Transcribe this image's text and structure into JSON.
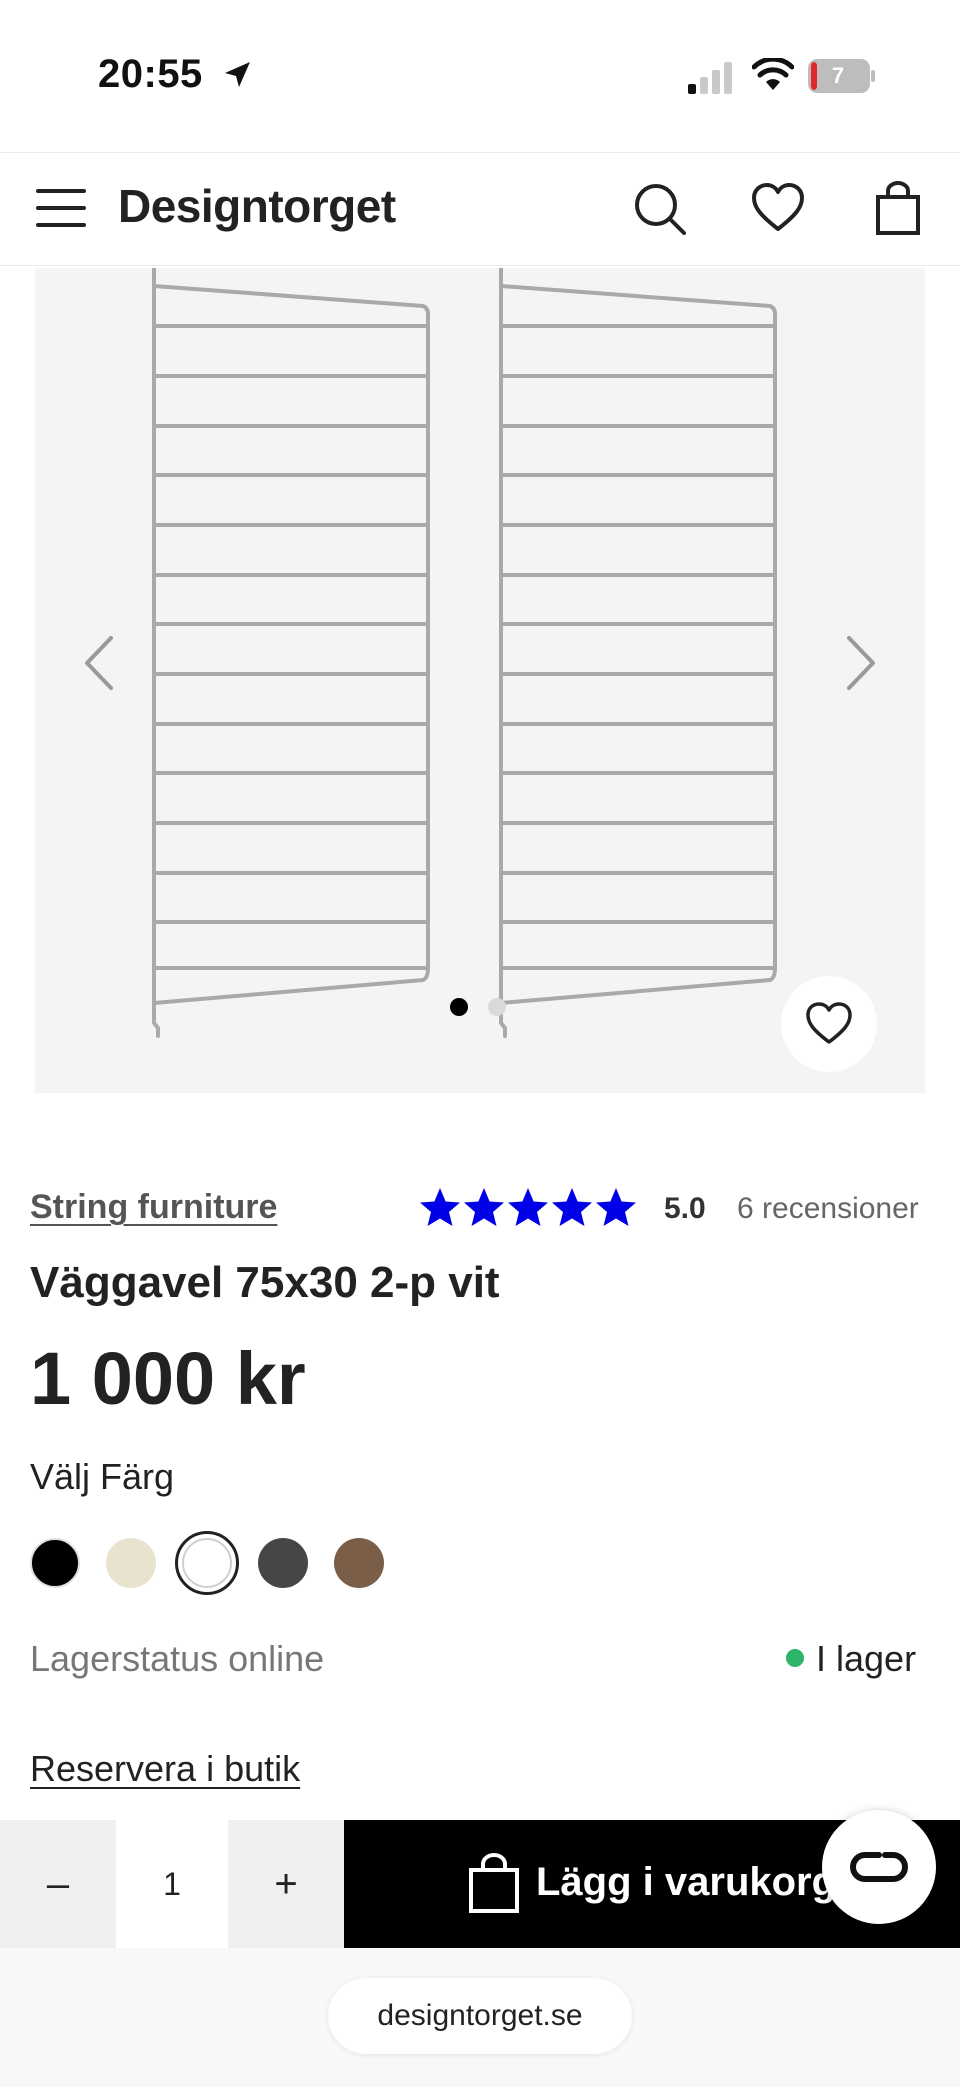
{
  "status_bar": {
    "time": "20:55",
    "battery_level": "7",
    "icons": [
      "location-arrow-icon",
      "cellular-signal-icon",
      "wifi-icon",
      "battery-icon"
    ]
  },
  "header": {
    "logo": "Designtorget",
    "icons": [
      "menu-icon",
      "search-icon",
      "heart-icon",
      "shopping-bag-icon"
    ]
  },
  "gallery": {
    "image_count": 2,
    "active_index": 1,
    "icons": [
      "chevron-left-icon",
      "chevron-right-icon",
      "heart-icon"
    ]
  },
  "product": {
    "brand": "String furniture",
    "rating": {
      "stars": 5,
      "max_stars": 5,
      "score": "5.0",
      "count_label": "6 recensioner",
      "star_color": "#0000e6"
    },
    "title": "Väggavel 75x30 2-p vit",
    "price": "1 000 kr",
    "color_label": "Välj Färg",
    "colors": [
      {
        "hex": "#000000",
        "selected": false
      },
      {
        "hex": "#e8e3cf",
        "selected": false
      },
      {
        "hex": "#ffffff",
        "selected": true
      },
      {
        "hex": "#464646",
        "selected": false
      },
      {
        "hex": "#7a5e47",
        "selected": false
      }
    ],
    "stock_label": "Lagerstatus online",
    "stock_value": "I lager",
    "stock_color": "#2db66a",
    "reserve_link": "Reservera i butik"
  },
  "buy_bar": {
    "minus": "–",
    "quantity": "1",
    "plus": "+",
    "add_to_cart": "Lägg i varukorgen"
  },
  "browser": {
    "url": "designtorget.se"
  }
}
